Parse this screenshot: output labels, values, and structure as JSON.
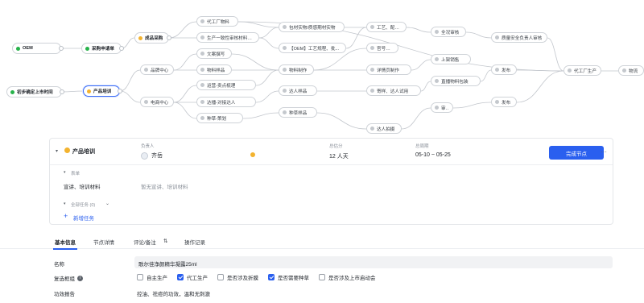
{
  "flow": {
    "nodes": [
      {
        "id": "oem",
        "label": "OEM",
        "dot": "green",
        "strong": true
      },
      {
        "id": "caigou_req",
        "label": "采购申请单",
        "dot": "green",
        "strong": true
      },
      {
        "id": "chengpin",
        "label": "成品采购",
        "dot": "amber",
        "strong": true
      },
      {
        "id": "daigong_wuliao",
        "label": "代工厂物料",
        "dot": "grey"
      },
      {
        "id": "shengchan_yizhi",
        "label": "生产一致性审核材料准备",
        "dot": "grey"
      },
      {
        "id": "baocai_shiwu",
        "label": "包材实物/质感期材实物",
        "dot": "grey"
      },
      {
        "id": "oem_gongyi",
        "label": "【OEM】工艺规程、批...",
        "dot": "grey"
      },
      {
        "id": "gongyi_peifang",
        "label": "工艺、配方审核",
        "dot": "grey"
      },
      {
        "id": "quanchang_shenhe",
        "label": "全况审核",
        "dot": "grey"
      },
      {
        "id": "zhiliang_anquan",
        "label": "质量安全负责人审核",
        "dot": "grey"
      },
      {
        "id": "daigongchang_shengchan",
        "label": "代工厂生产",
        "dot": "grey"
      },
      {
        "id": "wuliu",
        "label": "物流",
        "dot": "grey"
      },
      {
        "id": "chubu_queding",
        "label": "初步确定上市时间",
        "dot": "green",
        "strong": true
      },
      {
        "id": "chanpin_peixun",
        "label": "产品培训",
        "dot": "amber",
        "strong": true
      },
      {
        "id": "pinpai_zhongxin",
        "label": "品牌中心",
        "dot": "grey"
      },
      {
        "id": "dianshang_zhongxin",
        "label": "电商中心",
        "dot": "grey"
      },
      {
        "id": "wenan_zhuanxie",
        "label": "文案撰写",
        "dot": "grey"
      },
      {
        "id": "wuliao_yangpin",
        "label": "物料样品",
        "dot": "grey"
      },
      {
        "id": "wuliao_zhizuo",
        "label": "物料制作",
        "dot": "grey"
      },
      {
        "id": "yunying_maidian",
        "label": "运营-卖点梳理",
        "dot": "grey"
      },
      {
        "id": "dalian_daren",
        "label": "达播-对接达人",
        "dot": "grey"
      },
      {
        "id": "zhongcao_cehua",
        "label": "种草-策划",
        "dot": "grey"
      },
      {
        "id": "daren_yangpin",
        "label": "达人样品",
        "dot": "grey"
      },
      {
        "id": "zhongcao_yangpin",
        "label": "种草样品",
        "dot": "grey"
      },
      {
        "id": "guanhao_fabu",
        "label": "官号发布",
        "dot": "grey"
      },
      {
        "id": "xiangqingye_zhizuo",
        "label": "详情页制作",
        "dot": "grey"
      },
      {
        "id": "jiyang_daren",
        "label": "寄样、达人试用",
        "dot": "grey"
      },
      {
        "id": "daren_pailian",
        "label": "达人拍摄",
        "dot": "grey"
      },
      {
        "id": "shangjia_xiaoshou",
        "label": "上架销售",
        "dot": "grey"
      },
      {
        "id": "zhibo_wuliao",
        "label": "直播物料包装",
        "dot": "grey"
      },
      {
        "id": "shenhe",
        "label": "审核",
        "dot": "grey"
      },
      {
        "id": "fabu1",
        "label": "发布",
        "dot": "grey"
      },
      {
        "id": "fabu2",
        "label": "发布",
        "dot": "grey"
      }
    ]
  },
  "panel": {
    "node_name": "产品培训",
    "col_owner": "负责人",
    "col_score": "总估分",
    "col_period": "总周期",
    "owner_name": "齐岳",
    "score_value": "12 人天",
    "period_value": "05-10 ~ 05-25",
    "complete_button": "完成节点",
    "more": "···",
    "form_section": "表单",
    "field_label": "宣讲、培训材料",
    "field_empty": "暂无宣讲、培训材料",
    "all_tasks": "全部任务 (0)",
    "new_task": "新增任务"
  },
  "tabs": [
    {
      "label": "基本信息",
      "active": true
    },
    {
      "label": "节点详情",
      "active": false
    },
    {
      "label": "评论/备注",
      "active": false
    },
    {
      "label": "操作记录",
      "active": false
    }
  ],
  "form": {
    "name_label": "名称",
    "name_value": "歌尔佳净颜精华凝露25ml",
    "checkbox_label": "复选框组",
    "options": [
      {
        "label": "自主生产",
        "checked": false
      },
      {
        "label": "代工生产",
        "checked": true
      },
      {
        "label": "是否涉及折膜",
        "checked": false
      },
      {
        "label": "是否需要种草",
        "checked": true
      },
      {
        "label": "是否涉及上市启动会",
        "checked": false
      }
    ],
    "report_label": "功效报告",
    "report_value": "控油、祛痘的功效，温和无刺激"
  },
  "colors": {
    "accent": "#2a5fef",
    "green_dot": "#27b24a",
    "amber_dot": "#f3b32f"
  }
}
